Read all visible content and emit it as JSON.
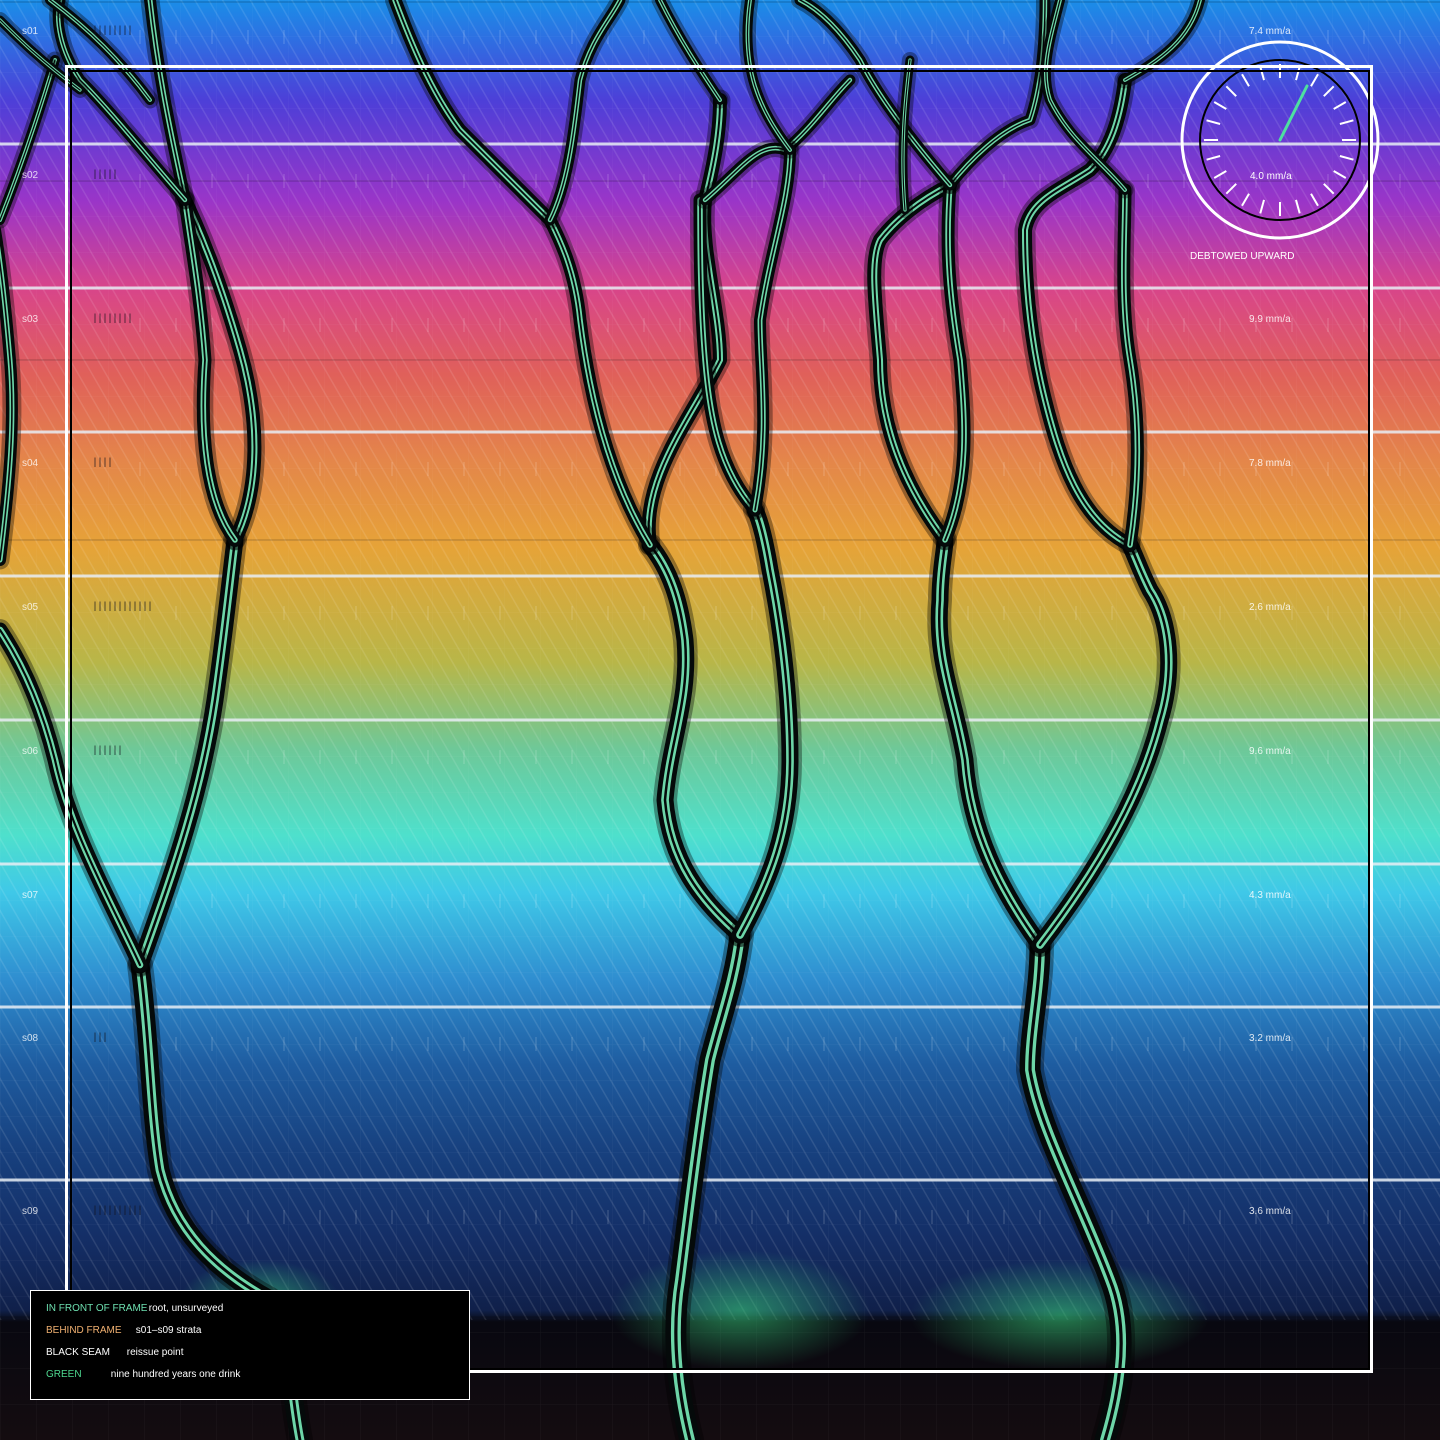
{
  "strata": [
    {
      "label": "s01",
      "ticks": "||||||||",
      "rate": "7.4 mm/a"
    },
    {
      "label": "s02",
      "ticks": "|||||",
      "rate": ""
    },
    {
      "label": "s03",
      "ticks": "||||||||",
      "rate": "9.9 mm/a"
    },
    {
      "label": "s04",
      "ticks": "||||",
      "rate": "7.8 mm/a"
    },
    {
      "label": "s05",
      "ticks": "||||||||||||",
      "rate": "2.6 mm/a"
    },
    {
      "label": "s06",
      "ticks": "||||||",
      "rate": "9.6 mm/a"
    },
    {
      "label": "s07",
      "ticks": "",
      "rate": "4.3 mm/a"
    },
    {
      "label": "s08",
      "ticks": "|||",
      "rate": "3.2 mm/a"
    },
    {
      "label": "s09",
      "ticks": "||||||||||",
      "rate": "3.6 mm/a"
    }
  ],
  "gauge": {
    "value": "4.0 mm/a",
    "caption": "DEBTOWED UPWARD",
    "needle_color": "#4ee0a0"
  },
  "legend": {
    "rows": [
      {
        "key": "IN FRONT OF FRAME",
        "desc": "root, unsurveyed",
        "color": "#6ee0b0"
      },
      {
        "key": "BEHIND FRAME",
        "desc": "s01–s09 strata",
        "color": "#f0b070"
      },
      {
        "key": "BLACK SEAM",
        "desc": "reissue point",
        "color": "#ffffff"
      },
      {
        "key": "GREEN",
        "desc": "nine hundred years one drink",
        "color": "#4ed890"
      }
    ]
  },
  "colors": {
    "root_outline": "#050a0a",
    "root_fill": "#6dd6a8",
    "root_highlight": "#b8fce0",
    "frame": "#ffffff",
    "band_line": "#e8eef5"
  }
}
